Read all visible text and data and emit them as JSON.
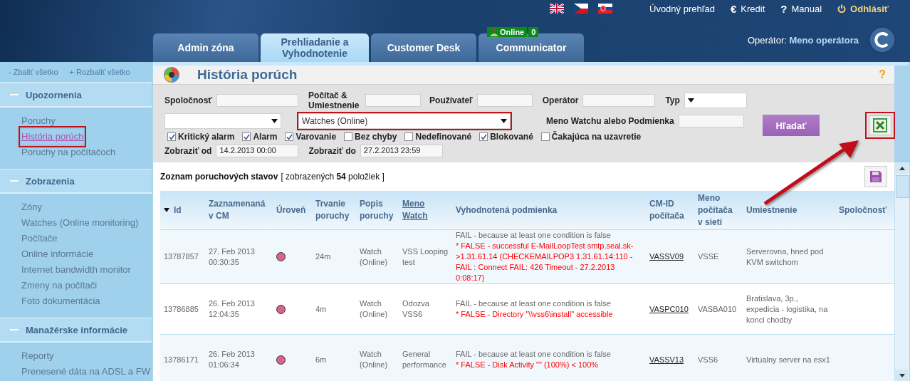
{
  "top_links": [
    {
      "kind": "plain",
      "label": "Úvodný prehľad"
    },
    {
      "kind": "glyph",
      "glyph": "€",
      "label": "Kredit"
    },
    {
      "kind": "glyph",
      "glyph": "?",
      "label": "Manual"
    },
    {
      "kind": "power",
      "label": "Odhlásiť"
    }
  ],
  "tabs": [
    {
      "label": "Admin zóna",
      "selected": false
    },
    {
      "label": "Prehliadanie a Vyhodnotenie",
      "selected": true
    },
    {
      "label": "Customer Desk",
      "selected": false
    },
    {
      "label": "Communicator",
      "selected": false,
      "badge": {
        "status": "Online",
        "count": "0"
      }
    }
  ],
  "operator": {
    "label": "Operátor:",
    "name": "Meno operátora"
  },
  "sidebar": {
    "actions": [
      {
        "glyph": "-",
        "label": "Zbaliť všetko"
      },
      {
        "glyph": "+",
        "label": "Rozbaliť všetko"
      }
    ],
    "sections": [
      {
        "title": "Upozornenia",
        "expanded": true,
        "items": [
          {
            "label": "Poruchy",
            "selected": false
          },
          {
            "label": "História porúch",
            "selected": true
          },
          {
            "label": "Poruchy na počítačoch",
            "selected": false
          }
        ]
      },
      {
        "title": "Zobrazenia",
        "expanded": true,
        "items": [
          {
            "label": "Zóny",
            "selected": false
          },
          {
            "label": "Watches (Online monitoring)",
            "selected": false
          },
          {
            "label": "Počítače",
            "selected": false
          },
          {
            "label": "Online informácie",
            "selected": false
          },
          {
            "label": "Internet bandwidth monitor",
            "selected": false
          },
          {
            "label": "Zmeny na počítači",
            "selected": false
          },
          {
            "label": "Foto dokumentácia",
            "selected": false
          }
        ]
      },
      {
        "title": "Manažérske informácie",
        "expanded": true,
        "items": [
          {
            "label": "Reporty",
            "selected": false
          },
          {
            "label": "Prenesené dáta na ADSL a FW",
            "selected": false
          }
        ]
      }
    ]
  },
  "page": {
    "title": "História porúch",
    "help": "?"
  },
  "filters": {
    "fields": [
      {
        "label": "Spoločnosť",
        "kind": "text"
      },
      {
        "label": "Počítač & Umiestnenie",
        "kind": "text"
      },
      {
        "label": "Používateľ",
        "kind": "text"
      },
      {
        "label": "Operátor",
        "kind": "text"
      },
      {
        "label": "Typ",
        "kind": "select"
      }
    ],
    "selects": [
      {
        "highlighted": false
      },
      {
        "value": "Watches (Online)",
        "highlighted": true
      }
    ],
    "watch_field": {
      "label": "Meno Watchu alebo Podmienka"
    },
    "search_button": "Hľadať",
    "export_button": {
      "highlighted": true
    },
    "checkboxes": [
      {
        "label": "Kritický alarm",
        "checked": true
      },
      {
        "label": "Alarm",
        "checked": true
      },
      {
        "label": "Varovanie",
        "checked": true
      },
      {
        "label": "Bez chyby",
        "checked": false
      },
      {
        "label": "Nedefinované",
        "checked": false
      },
      {
        "label": "Blokované",
        "checked": true
      },
      {
        "label": "Čakajúca na uzavretie",
        "checked": false
      }
    ],
    "dates": [
      {
        "label": "Zobraziť od",
        "value": "14.2.2013 00:00"
      },
      {
        "label": "Zobraziť do",
        "value": "27.2.2013 23:59"
      }
    ]
  },
  "list": {
    "title": "Zoznam poruchových stavov",
    "count": "[ zobrazených **54** položiek ]",
    "columns": [
      {
        "label": "Id",
        "sorted": true,
        "link": false
      },
      {
        "label": "Zaznamenaná v CM",
        "sorted": false,
        "link": false
      },
      {
        "label": "Úroveň",
        "sorted": false,
        "link": false
      },
      {
        "label": "Trvanie poruchy",
        "sorted": false,
        "link": false
      },
      {
        "label": "Popis poruchy",
        "sorted": false,
        "link": false
      },
      {
        "label": "Meno Watch",
        "sorted": false,
        "link": true
      },
      {
        "label": "Vyhodnotená podmienka",
        "sorted": false,
        "link": false
      },
      {
        "label": "CM-ID počítača",
        "sorted": false,
        "link": false
      },
      {
        "label": "Meno počítača v sieti",
        "sorted": false,
        "link": false
      },
      {
        "label": "Umiestnenie",
        "sorted": false,
        "link": false
      },
      {
        "label": "Spoločnosť",
        "sorted": false,
        "link": false
      }
    ],
    "rows": [
      {
        "id": "13787857",
        "recorded": "27. Feb 2013 00:30:35",
        "color": "#d9648c",
        "duration": "24m",
        "description": "Watch (Online)",
        "watch": "VSS Looping test",
        "condition": "FAIL - because at least one condition is false",
        "details": [
          "* FALSE - successful E-MailLoopTest smtp.seal.sk->1.31.61.14 (CHECKEMAILPOP3 1.31.61.14:110 - FAIL : Connect FAIL: 426 Timeout - 27.2.2013 0:08:17)"
        ],
        "cm_id": "VASSV09",
        "computer": "VSSE",
        "location": "Serverovna, hned pod KVM switchom"
      },
      {
        "id": "13786885",
        "recorded": "26. Feb 2013 12:04:35",
        "color": "#d9648c",
        "duration": "4m",
        "description": "Watch (Online)",
        "watch": "Odozva VSS6",
        "condition": "FAIL - because at least one condition is false",
        "details": [
          "* FALSE - Directory \"\\\\vss6\\install\" accessible"
        ],
        "cm_id": "VASPC010",
        "computer": "VASBA010",
        "location": "Bratislava, 3p., expedicia - logistika, na konci chodby"
      },
      {
        "id": "13786171",
        "recorded": "26. Feb 2013 01:06:34",
        "color": "#d9648c",
        "duration": "6m",
        "description": "Watch (Online)",
        "watch": "General performance",
        "condition": "FAIL - because at least one condition is false",
        "details": [
          "* FALSE - Disk Activity \"\" (100%) < 100%"
        ],
        "cm_id": "VASSV13",
        "computer": "VSS6",
        "location": "Virtualny server na esx1"
      }
    ]
  }
}
